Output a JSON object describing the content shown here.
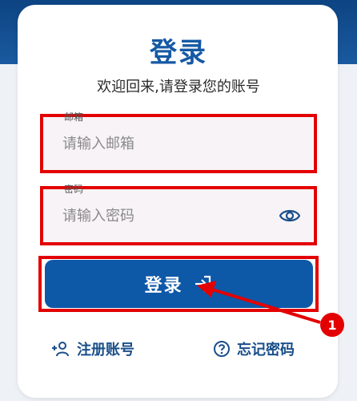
{
  "login": {
    "title": "登录",
    "subtitle": "欢迎回来,请登录您的账号",
    "email_label": "邮箱",
    "email_placeholder": "请输入邮箱",
    "password_label": "密码",
    "password_placeholder": "请输入密码",
    "submit_label": "登录",
    "register_label": "注册账号",
    "forgot_label": "忘记密码"
  },
  "annotation": {
    "badge": "1",
    "highlight_color": "#e30000"
  },
  "colors": {
    "primary": "#0e58a8",
    "title": "#1559a4",
    "link": "#1a4f8a"
  }
}
